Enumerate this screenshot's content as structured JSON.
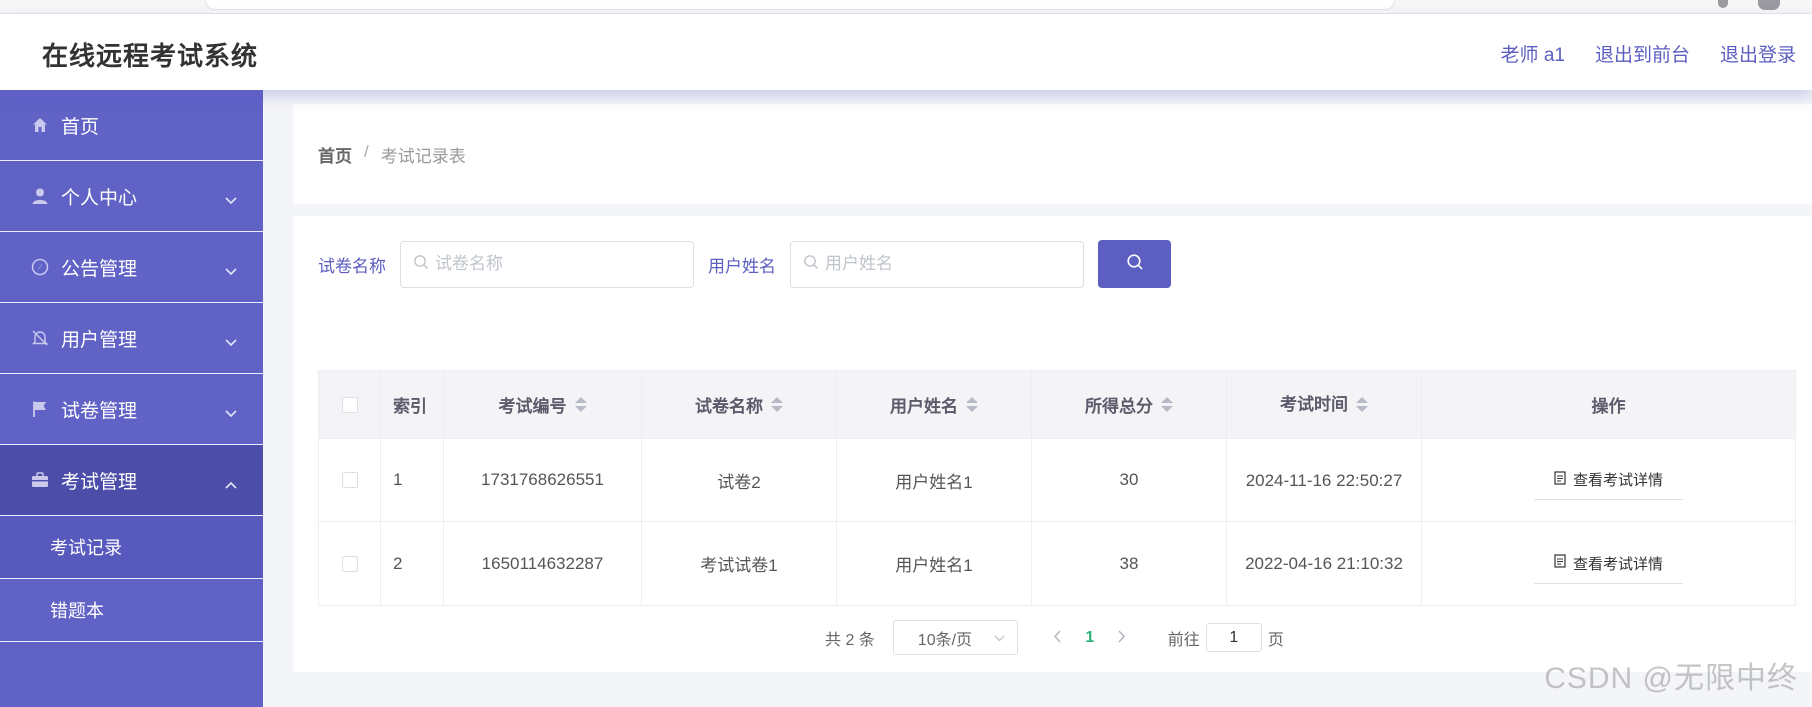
{
  "header": {
    "app_title": "在线远程考试系统",
    "links": {
      "user": "老师 a1",
      "frontend": "退出到前台",
      "logout": "退出登录"
    }
  },
  "sidebar": {
    "items": [
      {
        "label": "首页",
        "icon": "home-icon"
      },
      {
        "label": "个人中心",
        "icon": "person-icon"
      },
      {
        "label": "公告管理",
        "icon": "compass-icon"
      },
      {
        "label": "用户管理",
        "icon": "bell-off-icon"
      },
      {
        "label": "试卷管理",
        "icon": "flag-icon"
      },
      {
        "label": "考试管理",
        "icon": "briefcase-icon"
      }
    ],
    "submenu": [
      {
        "label": "考试记录"
      },
      {
        "label": "错题本"
      }
    ]
  },
  "breadcrumb": {
    "home": "首页",
    "separator": "/",
    "current": "考试记录表"
  },
  "search": {
    "paper_label": "试卷名称",
    "paper_placeholder": "试卷名称",
    "user_label": "用户姓名",
    "user_placeholder": "用户姓名"
  },
  "table": {
    "headers": {
      "index": "索引",
      "exam_no": "考试编号",
      "paper": "试卷名称",
      "user": "用户姓名",
      "score": "所得总分",
      "time": "考试时间",
      "action": "操作"
    },
    "rows": [
      {
        "index": "1",
        "exam_no": "1731768626551",
        "paper": "试卷2",
        "user": "用户姓名1",
        "score": "30",
        "time": "2024-11-16 22:50:27",
        "action": "查看考试详情"
      },
      {
        "index": "2",
        "exam_no": "1650114632287",
        "paper": "考试试卷1",
        "user": "用户姓名1",
        "score": "38",
        "time": "2022-04-16 21:10:32",
        "action": "查看考试详情"
      }
    ]
  },
  "pagination": {
    "total": "共 2 条",
    "page_size": "10条/页",
    "current_page": "1",
    "goto_prefix": "前往",
    "goto_value": "1",
    "goto_suffix": "页"
  },
  "watermark": "CSDN @无限中终",
  "colors": {
    "accent": "#5c5ec1",
    "sidebar": "#6062c6",
    "sidebar_active": "#4b4da9",
    "page_active": "#2eb37a"
  }
}
